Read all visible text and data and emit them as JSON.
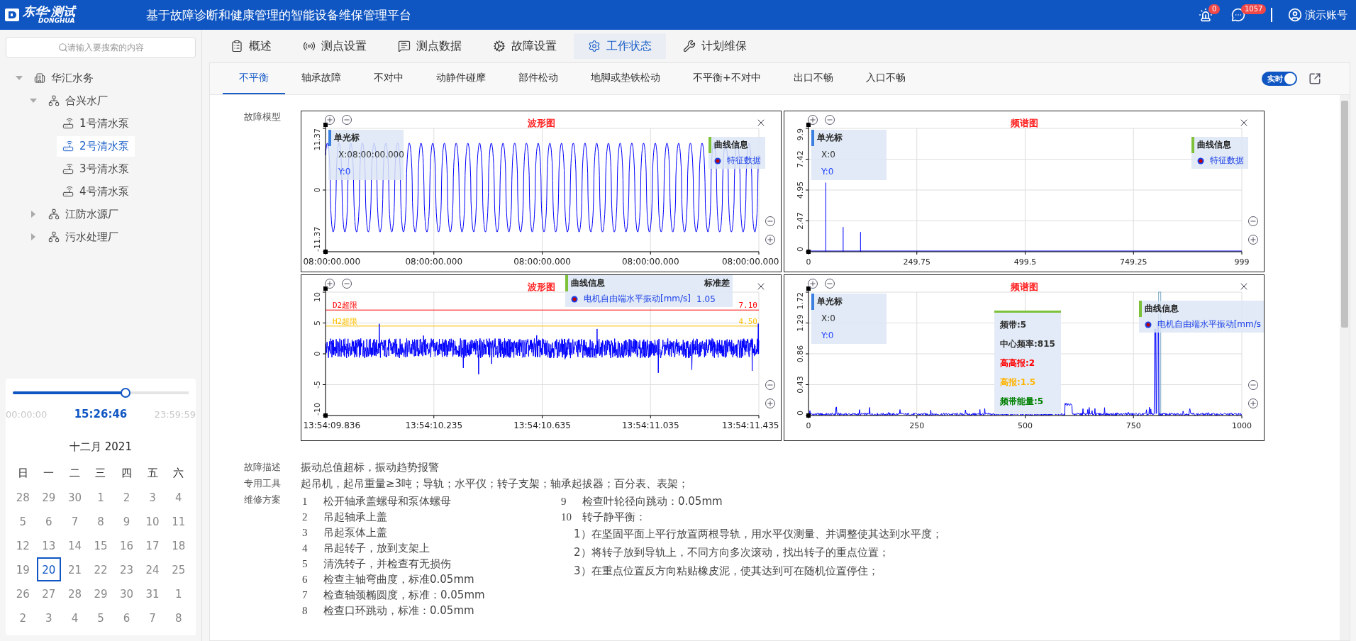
{
  "header": {
    "logo_cn": "东华·测试",
    "logo_en": "DONGHUA",
    "title": "基于故障诊断和健康管理的智能设备维保管理平台",
    "alarm_count": "0",
    "message_count": "1057",
    "user": "演示账号"
  },
  "sidebar": {
    "search": {
      "placeholder": "请输入要搜索的内容"
    },
    "tree": [
      {
        "label": "华汇水务",
        "kind": "company",
        "expanded": true,
        "children": [
          {
            "label": "合兴水厂",
            "kind": "plant",
            "expanded": true,
            "children": [
              {
                "label": "1号清水泵",
                "kind": "pump",
                "selected": false
              },
              {
                "label": "2号清水泵",
                "kind": "pump",
                "selected": true
              },
              {
                "label": "3号清水泵",
                "kind": "pump",
                "selected": false
              },
              {
                "label": "4号清水泵",
                "kind": "pump",
                "selected": false
              }
            ]
          },
          {
            "label": "江防水源厂",
            "kind": "plant",
            "expanded": false
          },
          {
            "label": "污水处理厂",
            "kind": "plant",
            "expanded": false
          }
        ]
      }
    ]
  },
  "time_slider": {
    "start": "00:00:00",
    "current": "15:26:46",
    "end": "23:59:59",
    "level": 0.64
  },
  "calendar": {
    "title": "十二月 2021",
    "weekdays": [
      "日",
      "一",
      "二",
      "三",
      "四",
      "五",
      "六"
    ],
    "days": [
      {
        "label": "28",
        "selected": false
      },
      {
        "label": "29",
        "selected": false
      },
      {
        "label": "30",
        "selected": false
      },
      {
        "label": "1",
        "selected": false
      },
      {
        "label": "2",
        "selected": false
      },
      {
        "label": "3",
        "selected": false
      },
      {
        "label": "4",
        "selected": false
      },
      {
        "label": "5",
        "selected": false
      },
      {
        "label": "6",
        "selected": false
      },
      {
        "label": "7",
        "selected": false
      },
      {
        "label": "8",
        "selected": false
      },
      {
        "label": "9",
        "selected": false
      },
      {
        "label": "10",
        "selected": false
      },
      {
        "label": "11",
        "selected": false
      },
      {
        "label": "12",
        "selected": false
      },
      {
        "label": "13",
        "selected": false
      },
      {
        "label": "14",
        "selected": false
      },
      {
        "label": "15",
        "selected": false
      },
      {
        "label": "16",
        "selected": false
      },
      {
        "label": "17",
        "selected": false
      },
      {
        "label": "18",
        "selected": false
      },
      {
        "label": "19",
        "selected": false
      },
      {
        "label": "20",
        "selected": true
      },
      {
        "label": "21",
        "selected": false
      },
      {
        "label": "22",
        "selected": false
      },
      {
        "label": "23",
        "selected": false
      },
      {
        "label": "24",
        "selected": false
      },
      {
        "label": "25",
        "selected": false
      },
      {
        "label": "26",
        "selected": false
      },
      {
        "label": "27",
        "selected": false
      },
      {
        "label": "28",
        "selected": false
      },
      {
        "label": "29",
        "selected": false
      },
      {
        "label": "30",
        "selected": false
      },
      {
        "label": "31",
        "selected": false
      },
      {
        "label": "1",
        "selected": false
      },
      {
        "label": "2",
        "selected": false
      },
      {
        "label": "3",
        "selected": false
      },
      {
        "label": "4",
        "selected": false
      },
      {
        "label": "5",
        "selected": false
      },
      {
        "label": "6",
        "selected": false
      },
      {
        "label": "7",
        "selected": false
      },
      {
        "label": "8",
        "selected": false
      }
    ]
  },
  "main_tabs": [
    {
      "label": "概述",
      "selected": false
    },
    {
      "label": "测点设置",
      "selected": false
    },
    {
      "label": "测点数据",
      "selected": false
    },
    {
      "label": "故障设置",
      "selected": false
    },
    {
      "label": "工作状态",
      "selected": true
    },
    {
      "label": "计划维保",
      "selected": false
    }
  ],
  "sub_tabs": [
    {
      "label": "不平衡",
      "selected": true
    },
    {
      "label": "轴承故障",
      "selected": false
    },
    {
      "label": "不对中",
      "selected": false
    },
    {
      "label": "动静件碰摩",
      "selected": false
    },
    {
      "label": "部件松动",
      "selected": false
    },
    {
      "label": "地脚或垫铁松动",
      "selected": false
    },
    {
      "label": "不平衡+不对中",
      "selected": false
    },
    {
      "label": "出口不畅",
      "selected": false
    },
    {
      "label": "入口不畅",
      "selected": false
    }
  ],
  "realtime": {
    "label": "实时",
    "on": true
  },
  "fault_model": {
    "label": "故障模型",
    "charts": [
      {
        "title": "波形图",
        "kind": "wave",
        "y_ticks": [
          "11.37",
          "0",
          "-11.37"
        ],
        "x_ticks": [
          "08:00:00.000",
          "08:00:00.000",
          "08:00:00.000",
          "08:00:00.000",
          "08:00:00.000"
        ],
        "cursor": {
          "title": "单光标",
          "x": "X:08:00:00.000",
          "y": "Y:0"
        },
        "legend": {
          "title": "曲线信息",
          "series": "特征数据"
        }
      },
      {
        "title": "频谱图",
        "kind": "spectrum",
        "y_ticks": [
          "9.9",
          "7.42",
          "4.95",
          "2.47",
          "0"
        ],
        "x_ticks": [
          "0",
          "249.75",
          "499.5",
          "749.25",
          "999"
        ],
        "cursor": {
          "title": "单光标",
          "x": "X:0",
          "y": "Y:0"
        },
        "legend": {
          "title": "曲线信息",
          "series": "特征数据"
        }
      },
      {
        "title": "波形图",
        "kind": "noise",
        "y_ticks": [
          "10",
          "5",
          "0",
          "-5",
          "-10"
        ],
        "x_ticks": [
          "13:54:09.836",
          "13:54:10.235",
          "13:54:10.635",
          "13:54:11.035",
          "13:54:11.435"
        ],
        "limits": [
          {
            "label": "D2超限",
            "value": "7.10",
            "color": "#ff0000"
          },
          {
            "label": "H2超限",
            "value": "4.50",
            "color": "#ffc000"
          }
        ],
        "legend": {
          "title": "曲线信息",
          "value_header": "标准差",
          "series": "电机自由端水平振动[mm/s]",
          "value": "1.05"
        }
      },
      {
        "title": "频谱图",
        "kind": "band_spectrum",
        "y_ticks": [
          "1.72",
          "1.29",
          "0.86",
          "0.43",
          "0"
        ],
        "x_ticks": [
          "0",
          "250",
          "500",
          "750",
          "1000"
        ],
        "cursor": {
          "title": "单光标",
          "x": "X:0",
          "y": "Y:0"
        },
        "band": [
          {
            "text": "频带:5",
            "color": "#333333"
          },
          {
            "text": "中心频率:815",
            "color": "#333333"
          },
          {
            "text": "高高报:2",
            "color": "#ff0000"
          },
          {
            "text": "高报:1.5",
            "color": "#ffb400"
          },
          {
            "text": "频带能量:5",
            "color": "#008000"
          }
        ],
        "legend": {
          "title": "曲线信息",
          "series": "电机自由端水平振动[mm/s"
        }
      }
    ]
  },
  "details": [
    {
      "label": "故障描述",
      "text": "振动总值超标，振动趋势报警"
    },
    {
      "label": "专用工具",
      "text": "起吊机，起吊重量≥3吨；导轨；水平仪；转子支架；轴承起拔器；百分表、表架；"
    }
  ],
  "repair": {
    "label": "维修方案",
    "left_steps": [
      {
        "no": "1",
        "text": "松开轴承盖螺母和泵体螺母"
      },
      {
        "no": "2",
        "text": "吊起轴承上盖"
      },
      {
        "no": "3",
        "text": "吊起泵体上盖"
      },
      {
        "no": "4",
        "text": "吊起转子，放到支架上"
      },
      {
        "no": "5",
        "text": "清洗转子，并检查有无损伤"
      },
      {
        "no": "6",
        "text": "检查主轴弯曲度，标准0.05mm"
      },
      {
        "no": "7",
        "text": "检查轴颈椭圆度，标准：0.05mm"
      },
      {
        "no": "8",
        "text": "检查口环跳动，标准：0.05mm"
      }
    ],
    "right_steps": [
      {
        "no": "9",
        "text": "检查叶轮径向跳动：0.05mm"
      },
      {
        "no": "10",
        "text": "转子静平衡：",
        "children": [
          "1）在坚固平面上平行放置两根导轨，用水平仪测量、并调整使其达到水平度；",
          "2）将转子放到导轨上，不同方向多次滚动，找出转子的重点位置；",
          "3）在重点位置反方向粘贴橡皮泥，使其达到可在随机位置停住；"
        ]
      }
    ]
  }
}
